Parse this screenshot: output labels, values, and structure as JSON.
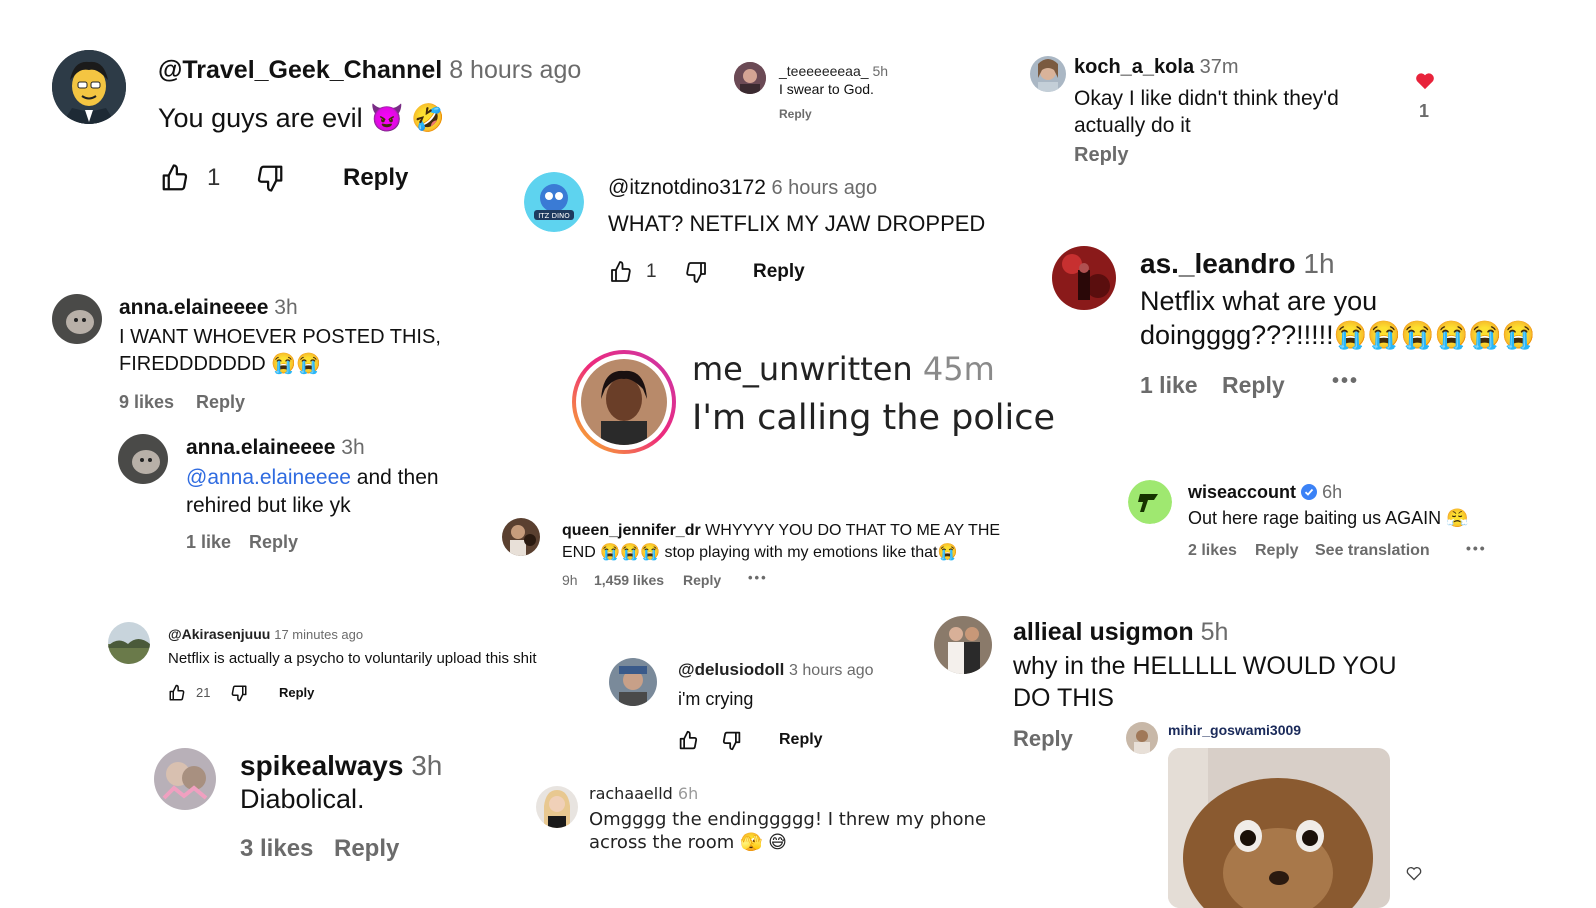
{
  "c1": {
    "user": "@Travel_Geek_Channel",
    "time": "8 hours ago",
    "text": "You guys are evil",
    "emoji": "😈 🤣",
    "likes": "1",
    "reply": "Reply"
  },
  "c2": {
    "user": "_teeeeeeeaa_",
    "time": "5h",
    "text": "I swear to God.",
    "reply": "Reply"
  },
  "c3": {
    "user": "koch_a_kola",
    "time": "37m",
    "line1": "Okay I like didn't think they'd",
    "line2": "actually do it",
    "reply": "Reply",
    "heart_count": "1"
  },
  "c4": {
    "user": "@itznotdino3172",
    "time": "6 hours ago",
    "text": "WHAT? NETFLIX MY JAW DROPPED",
    "likes": "1",
    "reply": "Reply",
    "avatar_label": "ITZ DINO"
  },
  "c5": {
    "user": "as._leandro",
    "time": "1h",
    "line1": "Netflix what are you",
    "line2": "doingggg???!!!!!",
    "emoji": "😭😭😭😭😭😭",
    "likes": "1 like",
    "reply": "Reply",
    "more": "•••"
  },
  "c6": {
    "user": "anna.elaineeee",
    "time": "3h",
    "line1": "I WANT WHOEVER POSTED THIS,",
    "line2": "FIREDDDDDDD",
    "emoji": "😭😭",
    "likes": "9 likes",
    "reply": "Reply"
  },
  "c7": {
    "user": "me_unwritten",
    "time": "45m",
    "text": "I'm calling the police"
  },
  "c8": {
    "user": "anna.elaineeee",
    "time": "3h",
    "mention": "@anna.elaineeee",
    "line1_rest": " and then",
    "line2": "rehired but like yk",
    "likes": "1 like",
    "reply": "Reply"
  },
  "c9": {
    "user": "wiseaccount",
    "time": "6h",
    "text": "Out here rage baiting us AGAIN",
    "emoji": "😤",
    "likes": "2 likes",
    "reply": "Reply",
    "translate": "See translation",
    "more": "•••"
  },
  "c10": {
    "user": "queen_jennifer_dr",
    "line1": "WHYYYY YOU DO THAT TO ME AY THE",
    "line2a": "END",
    "emoji1": "😭😭😭",
    "line2b": "stop playing with my emotions like that",
    "emoji2": "😭",
    "time": "9h",
    "likes": "1,459 likes",
    "reply": "Reply",
    "more": "•••"
  },
  "c11": {
    "user": "@Akirasenjuuu",
    "time": "17 minutes ago",
    "text": "Netflix is actually a psycho to voluntarily upload this shit",
    "likes": "21",
    "reply": "Reply"
  },
  "c12": {
    "user": "@delusiodoll",
    "time": "3 hours ago",
    "text": "i'm crying",
    "reply": "Reply"
  },
  "c13": {
    "user": "allieal usigmon",
    "time": "5h",
    "line1": "why in the HELLLLL WOULD YOU",
    "line2": "DO THIS",
    "reply": "Reply"
  },
  "c14": {
    "user": "mihir_goswami3009"
  },
  "c15": {
    "user": "spikealways",
    "time": "3h",
    "text": "Diabolical.",
    "likes": "3 likes",
    "reply": "Reply"
  },
  "c16": {
    "user": "rachaaelld",
    "time": "6h",
    "line1": "Omgggg the endinggggg! I threw my phone",
    "line2": "across the room",
    "emoji": "🫣 😅"
  },
  "colors": {
    "mention": "#2f6be0",
    "heart": "#e8233b",
    "verified": "#3b82f6",
    "muted": "#6b6b6b"
  }
}
